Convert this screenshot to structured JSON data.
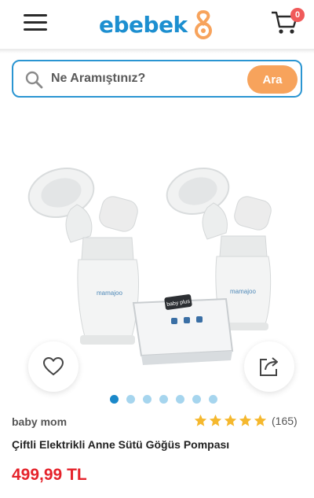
{
  "header": {
    "logo_text": "ebebek",
    "cart_count": "0",
    "brand_color": "#1d8fd0",
    "accent_color": "#f7a35c"
  },
  "search": {
    "placeholder": "Ne Aramıştınız?",
    "button_label": "Ara"
  },
  "product": {
    "brand": "baby mom",
    "title": "Çiftli Elektrikli Anne Sütü Göğüs Pompası",
    "price": "499,99 TL",
    "rating": 5,
    "review_count": "(165)",
    "image_labels": {
      "bottle_brand": "mamajoo",
      "device_brand": "baby plus"
    },
    "image_count": 7,
    "active_image_index": 0,
    "price_color": "#e5232b"
  }
}
